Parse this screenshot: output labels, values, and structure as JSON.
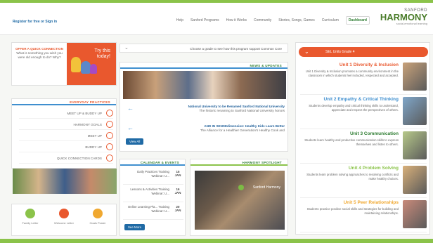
{
  "header": {
    "register_text": "Register for free or Sign in",
    "nav": [
      "Dashboard",
      "Curriculum",
      "Stories, Songs, Games",
      "Community",
      "How it Works",
      "Sanford Programs",
      "Help"
    ],
    "brand_top": "SANFORD",
    "brand_name": "HARMONY",
    "brand_tagline": "social-emotional learning"
  },
  "grade_selector": {
    "text": "SEL Units  Grade 4",
    "chevron": "chevron-down-icon"
  },
  "units": [
    {
      "title": "Unit 1 Diversity & Inclusion",
      "body": "Unit 1 Diversity & Inclusion promotes a community environment in the classroom in which students feel included, respected and accepted.",
      "color": "#e9582e"
    },
    {
      "title": "Unit 2 Empathy & Critical Thinking",
      "body": "Students develop empathy and critical thinking skills to understand, appreciate and respect the perspectives of others.",
      "color": "#3f8fcf"
    },
    {
      "title": "Unit 3 Communication",
      "body": "Students learn healthy and productive communication skills to express themselves and listen to others.",
      "color": "#2e7d32"
    },
    {
      "title": "Unit 4 Problem Solving",
      "body": "Students learn problem solving approaches to resolving conflicts and make healthy choices.",
      "color": "#8bc34a"
    },
    {
      "title": "Unit 5 Peer Relationships",
      "body": "Students practice positive social skills and strategies for building and maintaining relationships.",
      "color": "#f0a830"
    }
  ],
  "curriculum_dropdown": {
    "text": "Choose a grade to see how this program support Common Core",
    "chevron": "chevron-down-icon"
  },
  "news": {
    "heading": "NEWS & UPDATES",
    "items": [
      {
        "title": "National University to be Renamed Sanford National University",
        "body": "The historic renaming to Sanford National University honors"
      },
      {
        "title": "AND IN SENSEdimension: Healthy Kids Learn Better",
        "body": "The Alliance for a Healthier Generation's Healthy Cook and"
      }
    ],
    "view_all": "View All"
  },
  "spotlight": {
    "heading": "HARMONY SPOTLIGHT",
    "video_title": "Sanford Harmony"
  },
  "calendar": {
    "heading": "CALENDAR & EVENTS",
    "events": [
      {
        "day": "15",
        "month": "JAN",
        "title": "Daily Practices Training Webinar: U..."
      },
      {
        "day": "16",
        "month": "JAN",
        "title": "Lessons & Activities Training Webinar: U..."
      },
      {
        "day": "20",
        "month": "JAN",
        "title": "Online Learning Pla... Training Webinar: U..."
      }
    ],
    "view_more": "See More"
  },
  "promo": {
    "title_lines": [
      "Try this",
      "today!"
    ],
    "action": "OFFER A QUICK CONNECTION",
    "body": "What is something you wish you were old enough to do? Why?"
  },
  "practices": {
    "heading": "EVERYDAY PRACTICES",
    "items": [
      {
        "label": "MEET UP & BUDDY UP",
        "icon": "handshake-icon"
      },
      {
        "label": "HARMONY GOALS",
        "icon": "target-icon"
      },
      {
        "label": "MEET UP",
        "icon": "people-icon"
      },
      {
        "label": "BUDDY UP",
        "icon": "buddies-icon"
      },
      {
        "label": "QUICK CONNECTION CARDS",
        "icon": "cards-icon"
      }
    ]
  },
  "bottom_icons": [
    {
      "label": "Family Letter",
      "color": "#8bc34a",
      "icon": "letter-icon"
    },
    {
      "label": "Welcome Letter",
      "color": "#e9582e",
      "icon": "letter-icon"
    },
    {
      "label": "Goals Poster",
      "color": "#f0a830",
      "icon": "poster-icon"
    }
  ]
}
